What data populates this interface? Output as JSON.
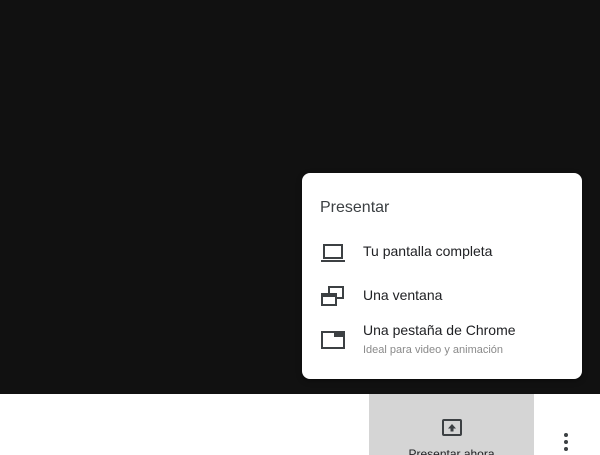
{
  "menu": {
    "title": "Presentar",
    "items": [
      {
        "icon": "laptop-icon",
        "label": "Tu pantalla completa",
        "sub": ""
      },
      {
        "icon": "window-icon",
        "label": "Una ventana",
        "sub": ""
      },
      {
        "icon": "tab-icon",
        "label": "Una pestaña de Chrome",
        "sub": "Ideal para video y animación"
      }
    ]
  },
  "bottom_bar": {
    "present_now_label": "Presentar ahora",
    "present_icon": "present-to-all-icon",
    "more_icon": "more-vert-icon"
  },
  "colors": {
    "video_background": "#111111",
    "button_background": "#d5d5d5",
    "icon_color": "#3c4043"
  }
}
